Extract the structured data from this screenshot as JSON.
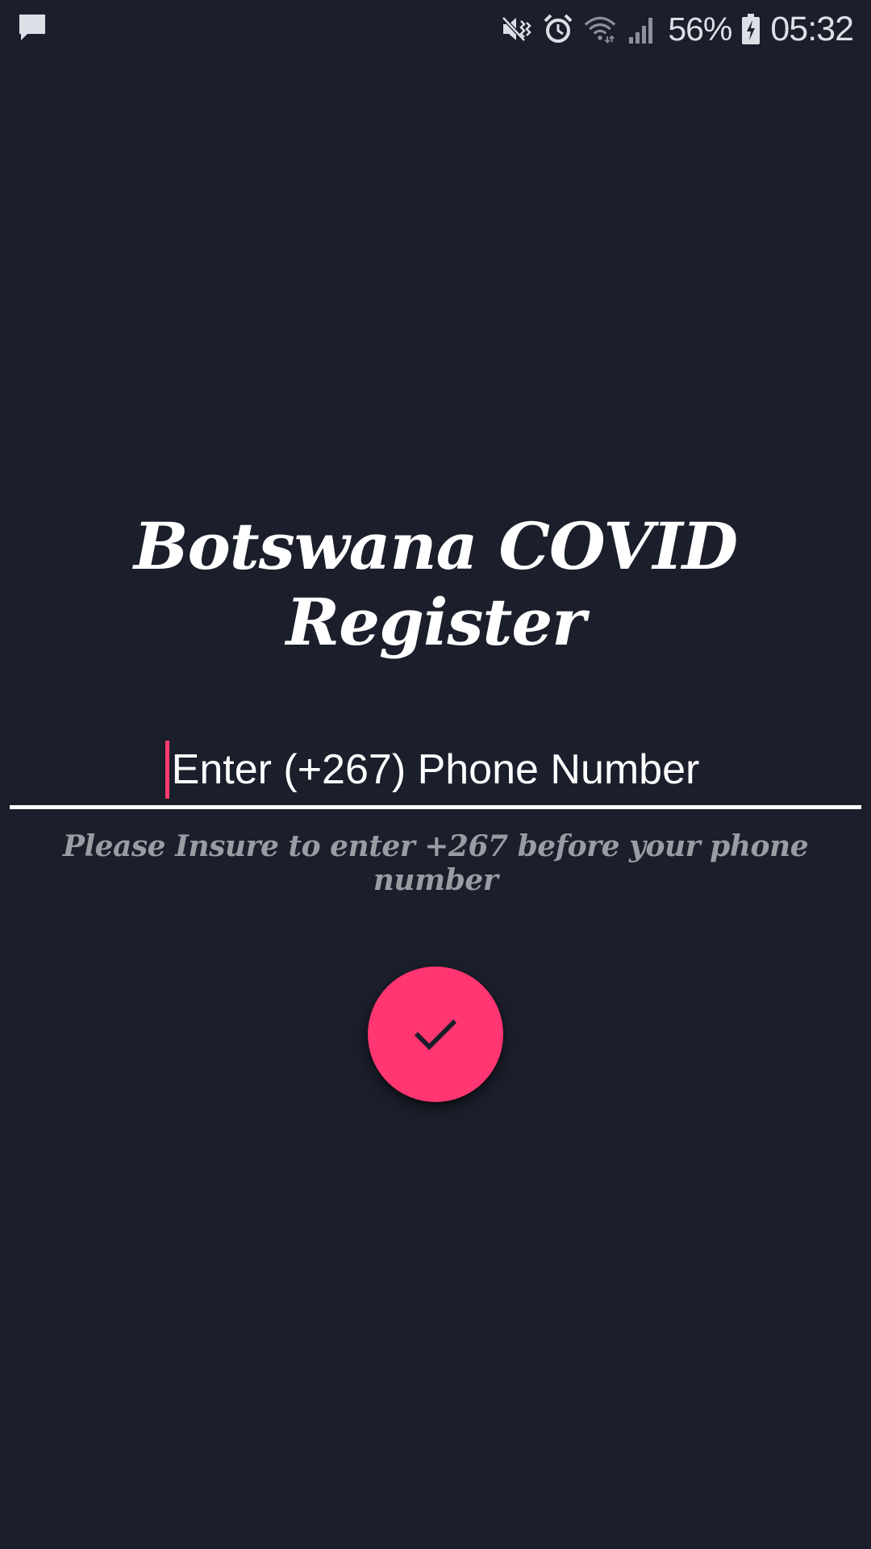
{
  "status_bar": {
    "notification_icon": "chat-bubble-icon",
    "icons": [
      "mute-vibrate-icon",
      "alarm-icon",
      "wifi-icon",
      "signal-icon",
      "battery-charging-icon"
    ],
    "battery_percent": "56%",
    "time": "05:32"
  },
  "main": {
    "title": "Botswana COVID Register",
    "phone_input": {
      "placeholder": "Enter (+267) Phone Number",
      "value": ""
    },
    "hint": "Please Insure to enter +267 before your phone number",
    "submit_icon": "check-icon"
  },
  "colors": {
    "background": "#1b1e2b",
    "accent": "#ff3671",
    "hint_text": "#9a9ba3",
    "title_text": "#ffffff"
  }
}
